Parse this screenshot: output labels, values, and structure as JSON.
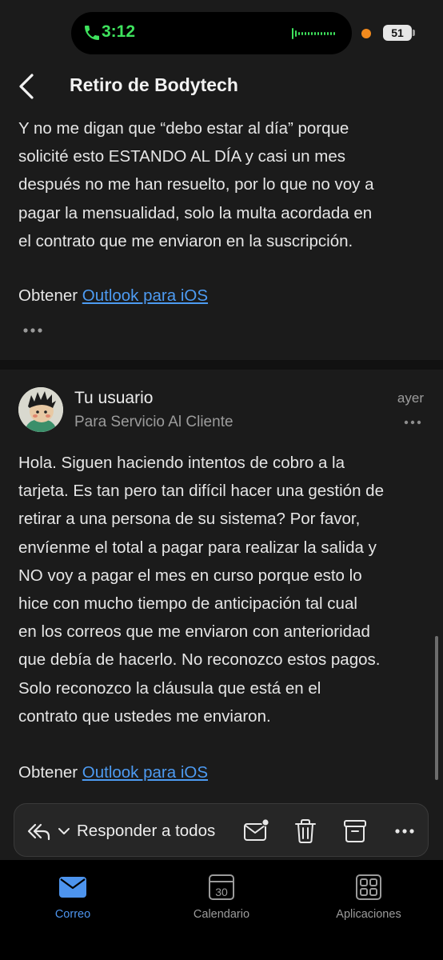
{
  "status_bar": {
    "time": "3:12",
    "battery": "51"
  },
  "header": {
    "title": "Retiro de Bodytech"
  },
  "message1": {
    "body_lines": [
      "Y no me digan que “debo estar al día” porque",
      "solicité esto ESTANDO AL DÍA y casi un mes",
      "después no me han resuelto, por lo que no voy a",
      "pagar la mensualidad, solo la multa acordada en",
      "el contrato que me enviaron en la suscripción."
    ],
    "get_prefix": "Obtener",
    "get_link": "Outlook para iOS"
  },
  "message2": {
    "sender": "Tu usuario",
    "recipient": "Para Servicio Al Cliente",
    "date": "ayer",
    "body_lines": [
      "Hola. Siguen haciendo intentos de cobro a la",
      "tarjeta. Es tan pero tan difícil hacer una gestión de",
      "retirar a una persona de su sistema? Por favor,",
      "envíenme el total a pagar para realizar la salida y",
      "NO voy a pagar el mes en curso porque esto lo",
      "hice con mucho tiempo de anticipación tal cual",
      "en los correos que me enviaron con anterioridad",
      "que debía de hacerlo. No reconozco estos pagos.",
      "Solo reconozco la cláusula que está en el",
      "contrato que ustedes me enviaron."
    ],
    "get_prefix": "Obtener",
    "get_link": "Outlook para iOS"
  },
  "toolbar": {
    "reply_all_label": "Responder a todos"
  },
  "tabs": [
    {
      "label": "Correo",
      "icon": "mail-icon",
      "active": true
    },
    {
      "label": "Calendario",
      "icon": "calendar-icon",
      "day": "30",
      "active": false
    },
    {
      "label": "Aplicaciones",
      "icon": "apps-grid-icon",
      "active": false
    }
  ],
  "colors": {
    "background": "#1b1b1b",
    "link": "#4d9bf2",
    "active_tab": "#4d94ee",
    "call_green": "#3ee25d"
  }
}
